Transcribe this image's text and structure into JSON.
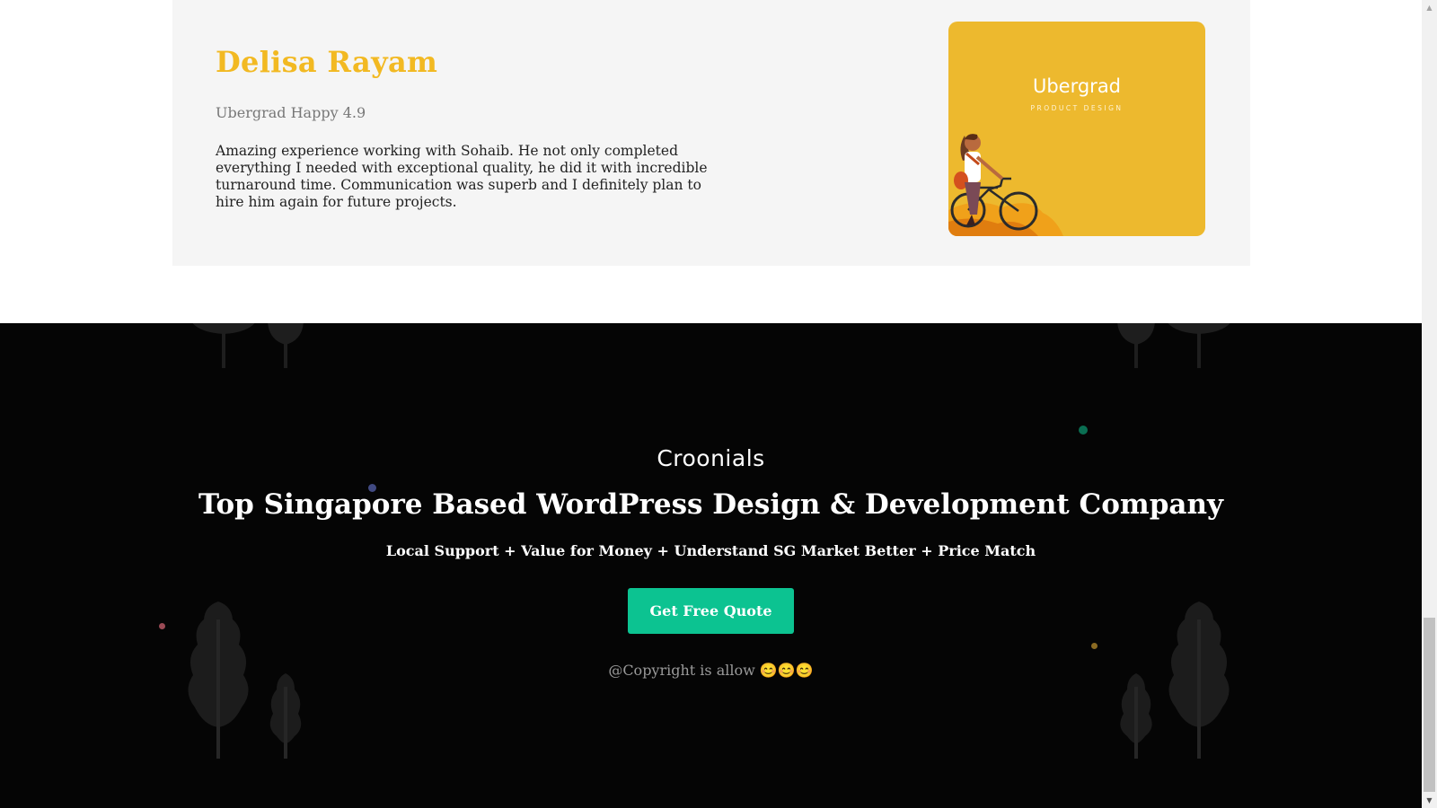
{
  "testimonial": {
    "name": "Delisa Rayam",
    "rating_line": "Ubergrad Happy 4.9",
    "review": "Amazing experience working with Sohaib. He not only completed everything I needed with exceptional quality, he did it with incredible turnaround time. Communication was superb and I definitely plan to hire him again for future projects.",
    "image": {
      "brand": "Ubergrad",
      "subtitle": "PRODUCT DESIGN",
      "icon": "woman-with-bicycle-illustration"
    }
  },
  "footer": {
    "logo": "Croonials",
    "headline": "Top Singapore Based WordPress Design & Development Company",
    "tagline": "Local Support + Value for Money + Understand SG Market Better + Price Match",
    "cta_label": "Get Free Quote",
    "copyright": "@Copyright is allow 😊😊😊"
  },
  "colors": {
    "accent_name": "#f2b922",
    "cta": "#0cc391",
    "footer_bg": "#050505",
    "card_bg": "#f5f5f5"
  },
  "scrollbar": {
    "up_arrow": "▲",
    "down_arrow": "▼"
  }
}
